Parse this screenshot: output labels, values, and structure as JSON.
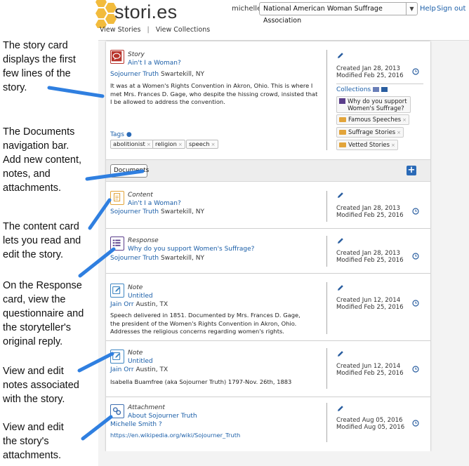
{
  "annotations": [
    "The story card\ndisplays the first\nfew lines of the\nstory.",
    "The Documents\nnavigation bar.\nAdd new content,\nnotes, and\nattachments.",
    "The content card\nlets you read and\nedit the story.",
    "On the Response\ncard, view the\nquestionnaire and\nthe storyteller's\noriginal reply.",
    "View and edit\nnotes associated\nwith the story.",
    "View and edit\nthe story's\nattachments."
  ],
  "header": {
    "logo": "stori.es",
    "username": "michelle",
    "organization": "National American Woman Suffrage Association",
    "help": "Help",
    "sign_out": "Sign out",
    "tabs": [
      "View Stories",
      "View Collections"
    ]
  },
  "story": {
    "type": "Story",
    "title": "Ain't I a Woman?",
    "author": "Sojourner Truth",
    "location": "Swartekill, NY",
    "excerpt": "It was at a Women's Rights Convention in Akron, Ohio.  This is where I met Mrs. Frances D. Gage, who despite the hissing crowd, insisted that I be allowed to address the convention.",
    "created": "Created Jan 28, 2013",
    "modified": "Modified Feb 25, 2016",
    "tags_label": "Tags",
    "tags": [
      "abolitionist",
      "religion",
      "speech"
    ],
    "collections_label": "Collections",
    "collections": [
      "Why do you support Women's Suffrage?",
      "Famous Speeches",
      "Suffrage Stories",
      "Vetted Stories"
    ]
  },
  "documents_bar": {
    "button": "Documents"
  },
  "cards": [
    {
      "type": "Content",
      "title": "Ain't I a Woman?",
      "author": "Sojourner Truth",
      "location": "Swartekill, NY",
      "body": "",
      "created": "Created Jan 28, 2013",
      "modified": "Modified Feb 25, 2016"
    },
    {
      "type": "Response",
      "title": "Why do you support Women's Suffrage?",
      "author": "Sojourner Truth",
      "location": "Swartekill, NY",
      "body": "",
      "created": "Created Jan 28, 2013",
      "modified": "Modified Feb 25, 2016"
    },
    {
      "type": "Note",
      "title": "Untitled",
      "author": "Jain Orr",
      "location": "Austin, TX",
      "body": "Speech delivered in 1851. Documented by Mrs. Frances D. Gage, the president of the Women's Rights Convention in Akron, Ohio. Addresses the religious concerns regarding women's rights.",
      "created": "Created Jun 12, 2014",
      "modified": "Modified Feb 25, 2016"
    },
    {
      "type": "Note",
      "title": "Untitled",
      "author": "Jain Orr",
      "location": "Austin, TX",
      "body": "Isabella Buamfree (aka Sojourner Truth) 1797-Nov. 26th, 1883",
      "created": "Created Jun 12, 2014",
      "modified": "Modified Feb 25, 2016"
    },
    {
      "type": "Attachment",
      "title": "About Sojourner Truth",
      "author": "Michelle Smith ?",
      "location": "",
      "body": "https://en.wikipedia.org/wiki/Sojourner_Truth",
      "created": "Created Aug 05, 2016",
      "modified": "Modified Aug 05, 2016"
    }
  ],
  "colors": {
    "link": "#1a5ea8",
    "story_icon": "#b8342c",
    "content_icon": "#e2a43a",
    "response_icon": "#5a3d8a",
    "note_icon": "#3f86c2",
    "attachment_icon": "#3f6fb0",
    "arrow": "#2f7fe0",
    "honeycomb": "#f2bb3c"
  },
  "icons": {
    "story": "speech-bubble-icon",
    "content": "document-icon",
    "response": "questionnaire-icon",
    "note": "pencil-note-icon",
    "attachment": "link-chain-icon",
    "edit": "pencil-icon",
    "history": "clock-icon",
    "add": "plus-icon"
  }
}
